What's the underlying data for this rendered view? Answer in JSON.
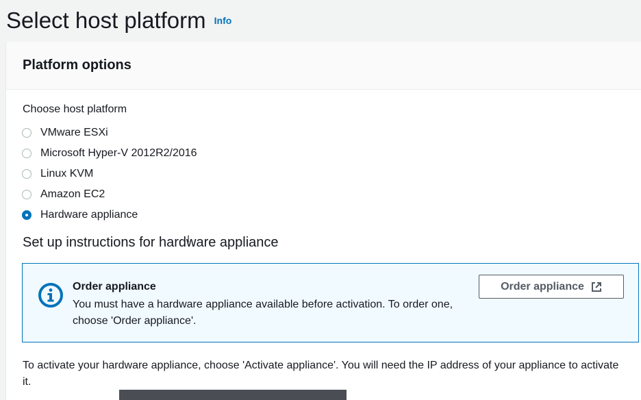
{
  "header": {
    "title": "Select host platform",
    "info_label": "Info"
  },
  "panel": {
    "title": "Platform options",
    "field_label": "Choose host platform",
    "options": [
      {
        "label": "VMware ESXi",
        "selected": false
      },
      {
        "label": "Microsoft Hyper-V 2012R2/2016",
        "selected": false
      },
      {
        "label": "Linux KVM",
        "selected": false
      },
      {
        "label": "Amazon EC2",
        "selected": false
      },
      {
        "label": "Hardware appliance",
        "selected": true
      }
    ],
    "section_title": "Set up instructions for hardware appliance",
    "alert": {
      "title": "Order appliance",
      "body": "You must have a hardware appliance available before activation. To order one, choose 'Order appliance'.",
      "button_label": "Order appliance",
      "icon": "info-circle-icon",
      "button_icon": "external-link-icon"
    },
    "footer_text": "To activate your hardware appliance, choose 'Activate appliance'. You will need the IP address of your appliance to activate it."
  },
  "colors": {
    "accent": "#0073bb",
    "alert_background": "#f1faff",
    "page_background": "#f2f3f3"
  }
}
